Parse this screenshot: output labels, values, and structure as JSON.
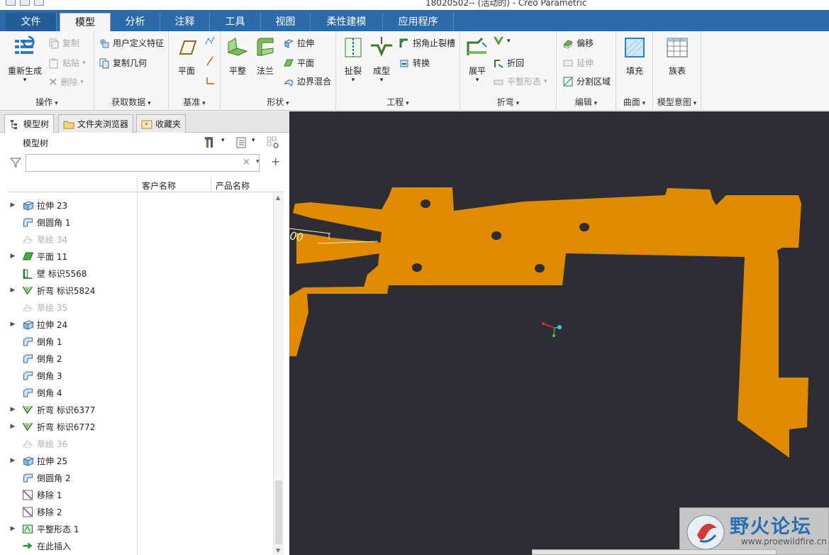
{
  "window": {
    "title": "18020502-- (活动的) - Creo Parametric"
  },
  "tabs": [
    "文件",
    "模型",
    "分析",
    "注释",
    "工具",
    "视图",
    "柔性建模",
    "应用程序"
  ],
  "ribbon": {
    "operations": {
      "label": "操作",
      "regenerate": "重新生成",
      "copy": "复制",
      "paste": "粘贴",
      "delete": "删除"
    },
    "get_data": {
      "label": "获取数据",
      "udf": "用户定义特征",
      "copy_geom": "复制几何"
    },
    "datum": {
      "label": "基准",
      "plane": "平面"
    },
    "shapes": {
      "label": "形状",
      "flatten": "平整",
      "flange": "法兰",
      "extrude": "拉伸",
      "planar": "平面",
      "boundary_blend": "边界混合"
    },
    "engineering": {
      "label": "工程",
      "rip": "扯裂",
      "form": "成型",
      "corner_relief": "拐角止裂槽",
      "convert": "转换"
    },
    "bends": {
      "label": "折弯",
      "unbend": "展平",
      "bend_back": "折回",
      "flat_state": "平整形态"
    },
    "editing": {
      "label": "编辑",
      "offset": "偏移",
      "extend": "延伸",
      "split_area": "分割区域"
    },
    "surfaces": {
      "label": "曲面",
      "fill": "填充"
    },
    "model_intent": {
      "label": "模型意图",
      "family_table": "族表"
    }
  },
  "navigator": {
    "tabs": [
      "模型树",
      "文件夹浏览器",
      "收藏夹"
    ],
    "panel_title": "模型树",
    "filter_placeholder": "",
    "columns": [
      "客户名称",
      "产品名称"
    ],
    "items": [
      {
        "label": "拉伸 23",
        "expandable": true,
        "dim": false,
        "icon": "extrude-icon"
      },
      {
        "label": "倒圆角 1",
        "expandable": false,
        "dim": false,
        "icon": "round-icon"
      },
      {
        "label": "草绘 34",
        "expandable": false,
        "dim": true,
        "icon": "sketch-icon"
      },
      {
        "label": "平面 11",
        "expandable": true,
        "dim": false,
        "icon": "planar-wall-icon"
      },
      {
        "label": "壁 标识5568",
        "expandable": false,
        "dim": false,
        "icon": "wall-icon"
      },
      {
        "label": "折弯 标识5824",
        "expandable": true,
        "dim": false,
        "icon": "bend-icon"
      },
      {
        "label": "草绘 35",
        "expandable": false,
        "dim": true,
        "icon": "sketch-icon"
      },
      {
        "label": "拉伸 24",
        "expandable": true,
        "dim": false,
        "icon": "extrude-icon"
      },
      {
        "label": "倒角 1",
        "expandable": false,
        "dim": false,
        "icon": "chamfer-icon"
      },
      {
        "label": "倒角 2",
        "expandable": false,
        "dim": false,
        "icon": "chamfer-icon"
      },
      {
        "label": "倒角 3",
        "expandable": false,
        "dim": false,
        "icon": "chamfer-icon"
      },
      {
        "label": "倒角 4",
        "expandable": false,
        "dim": false,
        "icon": "chamfer-icon"
      },
      {
        "label": "折弯 标识6377",
        "expandable": true,
        "dim": false,
        "icon": "bend-icon"
      },
      {
        "label": "折弯 标识6772",
        "expandable": true,
        "dim": false,
        "icon": "bend-icon"
      },
      {
        "label": "草绘 36",
        "expandable": false,
        "dim": true,
        "icon": "sketch-icon"
      },
      {
        "label": "拉伸 25",
        "expandable": true,
        "dim": false,
        "icon": "extrude-icon"
      },
      {
        "label": "倒圆角 2",
        "expandable": false,
        "dim": false,
        "icon": "round-icon"
      },
      {
        "label": "移除 1",
        "expandable": false,
        "dim": false,
        "icon": "remove-icon"
      },
      {
        "label": "移除 2",
        "expandable": false,
        "dim": false,
        "icon": "remove-icon"
      },
      {
        "label": "平整形态 1",
        "expandable": true,
        "dim": false,
        "icon": "flat-state-icon"
      },
      {
        "label": "在此插入",
        "expandable": false,
        "dim": false,
        "icon": "insert-here-icon"
      }
    ]
  },
  "viewport": {
    "dimension_text": "00"
  },
  "colors": {
    "part": "#e08a00",
    "background": "#2e2d33",
    "tab_bar": "#2c6aa8",
    "watermark": "#2a6fb0"
  },
  "watermark": {
    "text": "野火论坛",
    "url": "www.proewildfire.cn"
  }
}
